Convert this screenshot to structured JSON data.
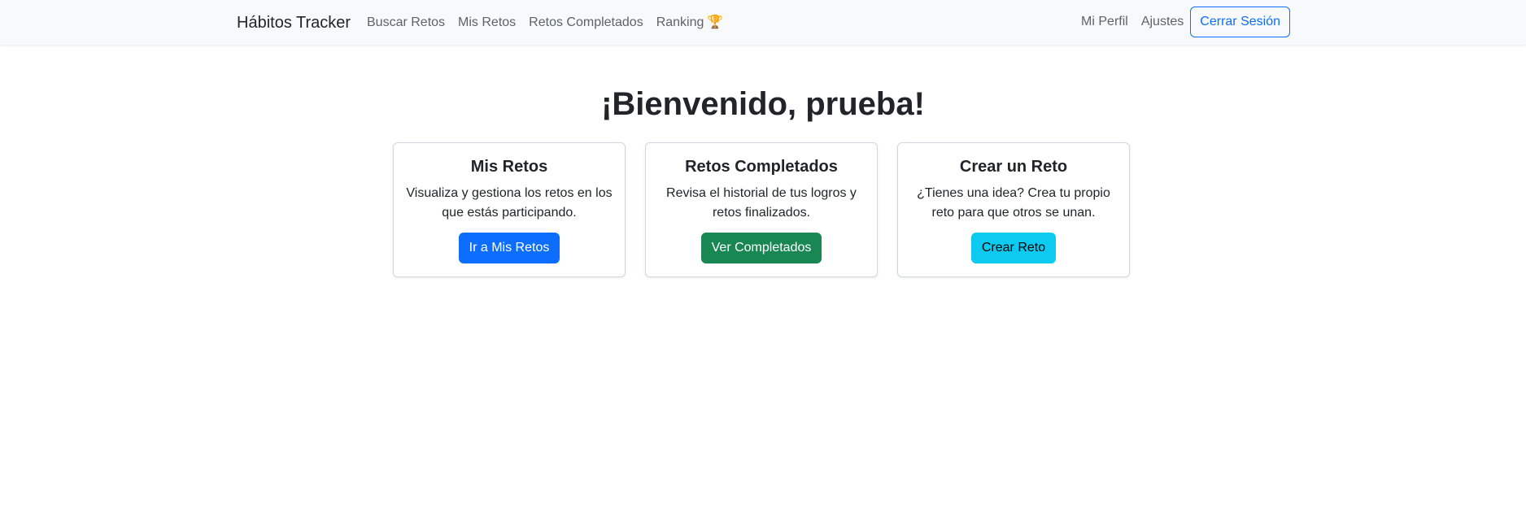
{
  "navbar": {
    "brand": "Hábitos Tracker",
    "links": [
      {
        "label": "Buscar Retos"
      },
      {
        "label": "Mis Retos"
      },
      {
        "label": "Retos Completados"
      },
      {
        "label": "Ranking",
        "icon": "trophy-icon"
      }
    ],
    "right_links": [
      {
        "label": "Mi Perfil"
      },
      {
        "label": "Ajustes"
      }
    ],
    "logout_label": "Cerrar Sesión"
  },
  "main": {
    "title": "¡Bienvenido, prueba!",
    "cards": [
      {
        "title": "Mis Retos",
        "text": "Visualiza y gestiona los retos en los que estás participando.",
        "button": "Ir a Mis Retos",
        "button_color": "#0d6efd"
      },
      {
        "title": "Retos Completados",
        "text": "Revisa el historial de tus logros y retos finalizados.",
        "button": "Ver Completados",
        "button_color": "#198754"
      },
      {
        "title": "Crear un Reto",
        "text": "¿Tienes una idea? Crea tu propio reto para que otros se unan.",
        "button": "Crear Reto",
        "button_color": "#0dcaf0"
      }
    ]
  }
}
